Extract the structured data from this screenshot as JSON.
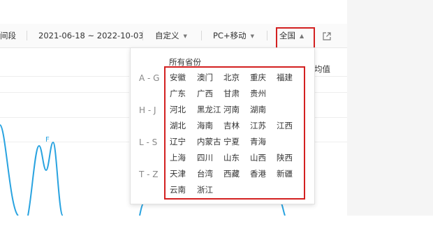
{
  "toolbar": {
    "period_label": "间段",
    "date_range": "2021-06-18 ~ 2022-10-03",
    "custom_label": "自定义",
    "device_label": "PC+移动",
    "region_label": "全国"
  },
  "chart": {
    "peak_label": "F",
    "avg_label": "均值",
    "line_color": "#29a3e0"
  },
  "province_dropdown": {
    "title": "所有省份",
    "groups": [
      "A - G",
      "H - J",
      "L - S",
      "T - Z"
    ],
    "rows": [
      [
        "安徽",
        "澳门",
        "北京",
        "重庆",
        "福建"
      ],
      [
        "广东",
        "广西",
        "甘肃",
        "贵州"
      ],
      [
        "河北",
        "黑龙江",
        "河南",
        "湖南"
      ],
      [
        "湖北",
        "海南",
        "吉林",
        "江苏",
        "江西"
      ],
      [
        "辽宁",
        "内蒙古",
        "宁夏",
        "青海"
      ],
      [
        "上海",
        "四川",
        "山东",
        "山西",
        "陕西"
      ],
      [
        "天津",
        "台湾",
        "西藏",
        "香港",
        "新疆"
      ],
      [
        "云南",
        "浙江"
      ]
    ]
  },
  "colors": {
    "highlight": "#d32020",
    "accent": "#29a3e0"
  }
}
